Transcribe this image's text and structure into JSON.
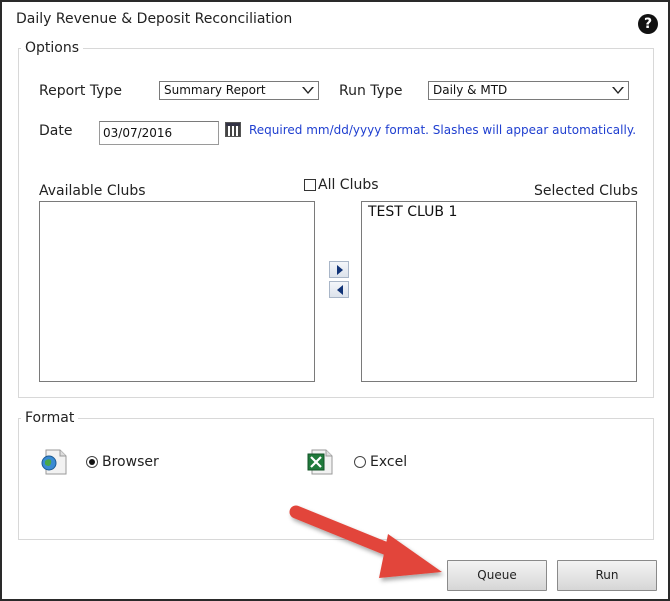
{
  "window": {
    "title": "Daily Revenue & Deposit Reconciliation",
    "help_glyph": "?"
  },
  "options": {
    "legend": "Options",
    "report_type": {
      "label": "Report Type",
      "value": "Summary Report"
    },
    "run_type": {
      "label": "Run Type",
      "value": "Daily & MTD"
    },
    "date": {
      "label": "Date",
      "value": "03/07/2016",
      "hint": "Required mm/dd/yyyy format. Slashes will appear automatically."
    },
    "all_clubs": {
      "label": "All Clubs",
      "checked": false
    },
    "available_clubs": {
      "label": "Available Clubs",
      "items": []
    },
    "selected_clubs": {
      "label": "Selected Clubs",
      "items": [
        "TEST CLUB 1"
      ]
    }
  },
  "format": {
    "legend": "Format",
    "browser": {
      "label": "Browser",
      "checked": true,
      "icon": "browser-file-icon"
    },
    "excel": {
      "label": "Excel",
      "checked": false,
      "icon": "excel-file-icon"
    }
  },
  "actions": {
    "queue_label": "Queue",
    "run_label": "Run"
  },
  "colors": {
    "hint": "#1f3fd0",
    "annotation_arrow": "#e2453a"
  }
}
